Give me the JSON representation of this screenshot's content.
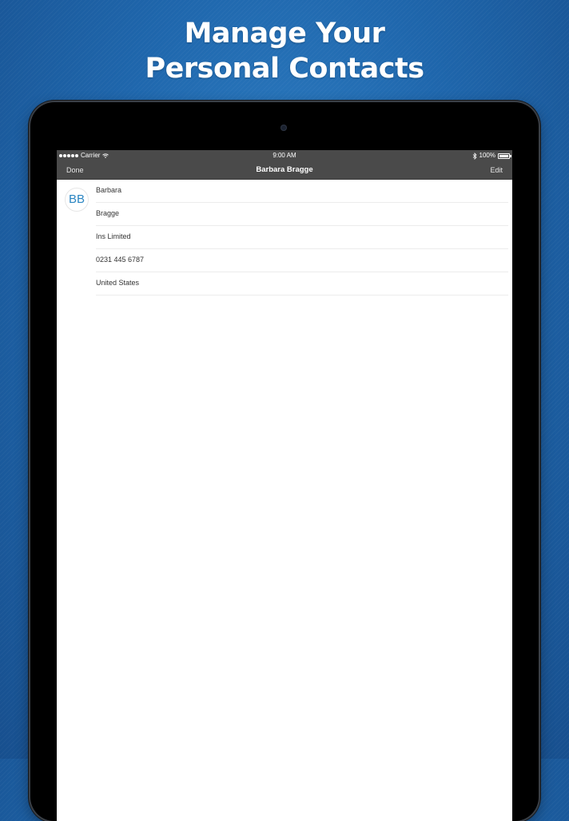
{
  "headline": {
    "line1": "Manage Your",
    "line2": "Personal Contacts"
  },
  "status_bar": {
    "carrier": "Carrier",
    "time": "9:00 AM",
    "battery": "100%",
    "icons": [
      "signal-icon",
      "wifi-icon",
      "bluetooth-icon",
      "battery-icon"
    ]
  },
  "nav": {
    "left_label": "Done",
    "title": "Barbara Bragge",
    "right_label": "Edit"
  },
  "contact": {
    "initials": "BB",
    "fields": [
      "Barbara",
      "Bragge",
      "Ins Limited",
      "0231 445 6787",
      "United States"
    ]
  },
  "colors": {
    "background": "#1f67ad",
    "navbar": "#4a4a4a",
    "avatar_text": "#2a85c2"
  }
}
